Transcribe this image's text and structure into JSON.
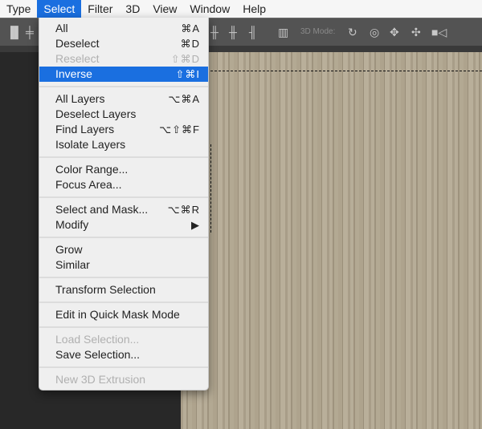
{
  "menubar": [
    "Type",
    "Select",
    "Filter",
    "3D",
    "View",
    "Window",
    "Help"
  ],
  "toolbar": {
    "mode_label": "3D Mode:",
    "icons": [
      "align-top-icon",
      "align-vcenter-icon",
      "distribute-icon",
      "distribute-hcenter-icon",
      "distribute-right-icon",
      "auto-align-icon",
      "3d-orbit-icon",
      "3d-roll-icon",
      "3d-pan-icon",
      "3d-slide-icon",
      "3d-scale-video-icon"
    ]
  },
  "menu": {
    "groups": [
      [
        {
          "label": "All",
          "shortcut": "⌘A"
        },
        {
          "label": "Deselect",
          "shortcut": "⌘D"
        },
        {
          "label": "Reselect",
          "shortcut": "⇧⌘D",
          "disabled": true
        },
        {
          "label": "Inverse",
          "shortcut": "⇧⌘I",
          "highlighted": true
        }
      ],
      [
        {
          "label": "All Layers",
          "shortcut": "⌥⌘A"
        },
        {
          "label": "Deselect Layers",
          "shortcut": ""
        },
        {
          "label": "Find Layers",
          "shortcut": "⌥⇧⌘F"
        },
        {
          "label": "Isolate Layers",
          "shortcut": ""
        }
      ],
      [
        {
          "label": "Color Range...",
          "shortcut": ""
        },
        {
          "label": "Focus Area...",
          "shortcut": ""
        }
      ],
      [
        {
          "label": "Select and Mask...",
          "shortcut": "⌥⌘R"
        },
        {
          "label": "Modify",
          "shortcut": "▶"
        }
      ],
      [
        {
          "label": "Grow",
          "shortcut": ""
        },
        {
          "label": "Similar",
          "shortcut": ""
        }
      ],
      [
        {
          "label": "Transform Selection",
          "shortcut": ""
        }
      ],
      [
        {
          "label": "Edit in Quick Mask Mode",
          "shortcut": ""
        }
      ],
      [
        {
          "label": "Load Selection...",
          "shortcut": "",
          "disabled": true
        },
        {
          "label": "Save Selection...",
          "shortcut": ""
        }
      ],
      [
        {
          "label": "New 3D Extrusion",
          "shortcut": "",
          "disabled": true
        }
      ]
    ]
  },
  "colors": {
    "highlight": "#1a6fe0"
  }
}
